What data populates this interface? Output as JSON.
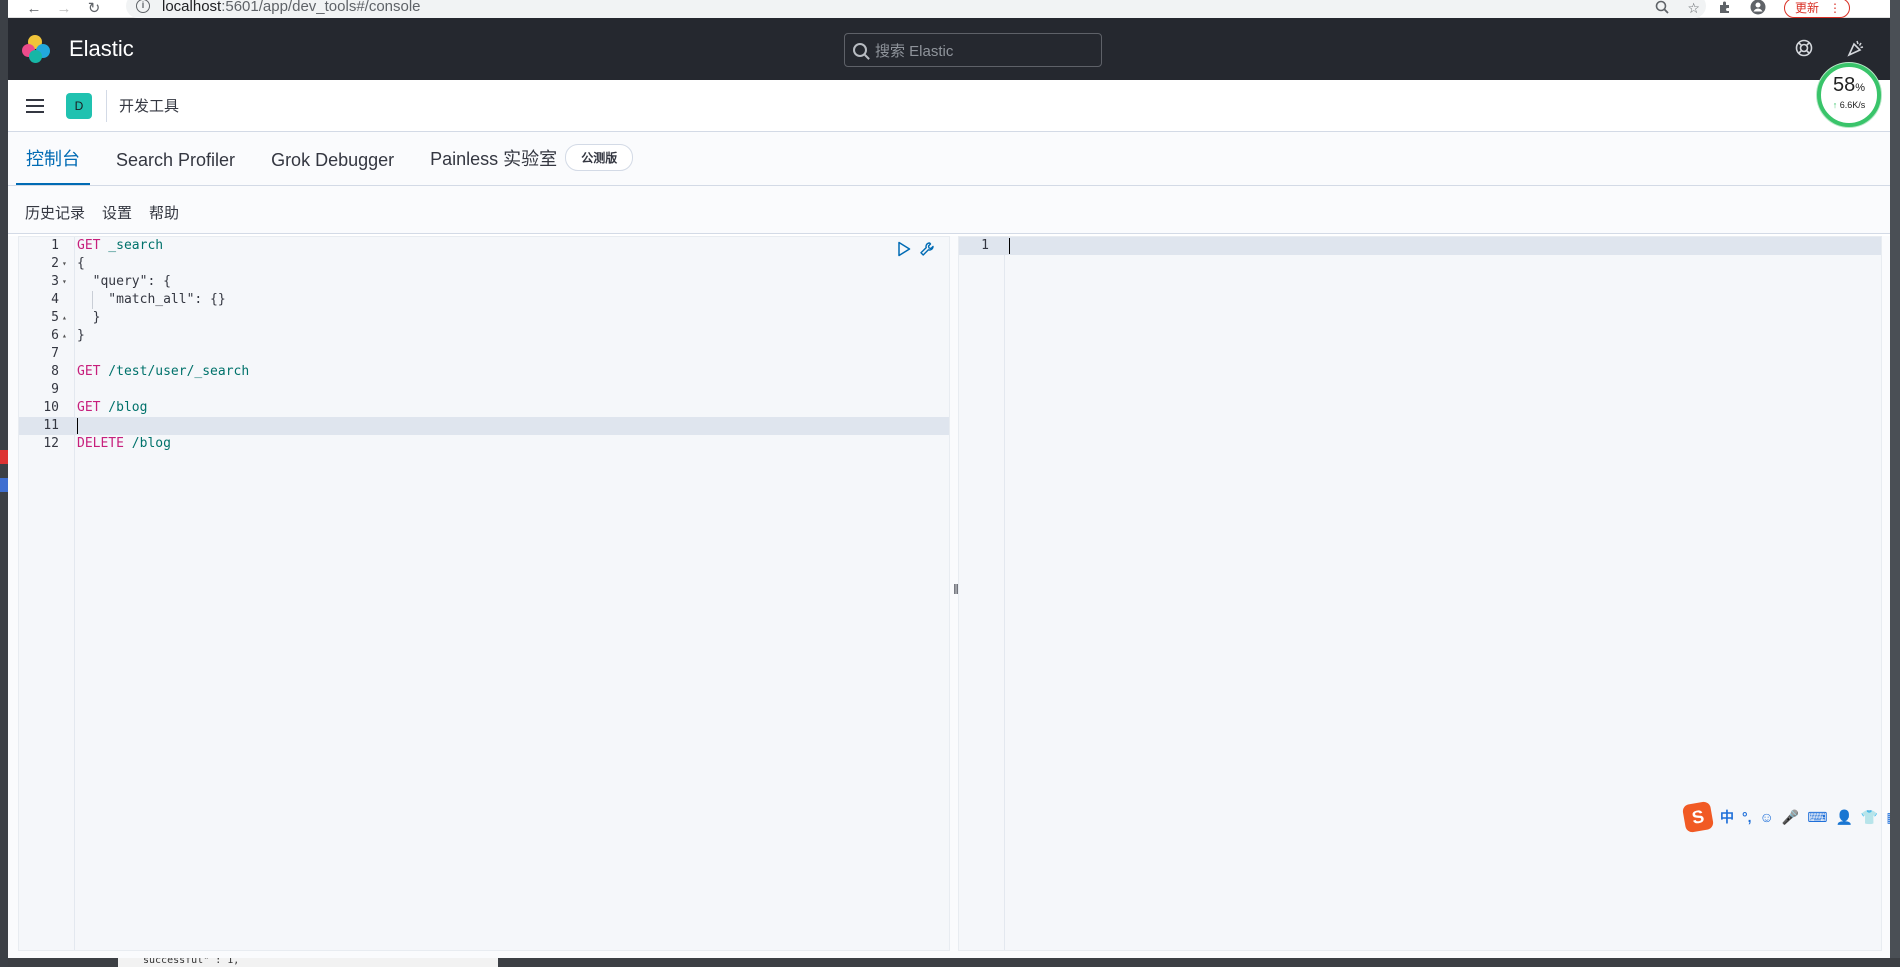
{
  "browser": {
    "url_host": "localhost",
    "url_path": ":5601/app/dev_tools#/console",
    "update_label": "更新",
    "menu_glyph": "⋮"
  },
  "header": {
    "brand": "Elastic",
    "search_placeholder": "搜索 Elastic",
    "icons": [
      "help-icon",
      "newsfeed-icon"
    ]
  },
  "breadcrumb": {
    "space_initial": "D",
    "current": "开发工具"
  },
  "tabs": [
    {
      "label": "控制台",
      "active": true
    },
    {
      "label": "Search Profiler",
      "active": false
    },
    {
      "label": "Grok Debugger",
      "active": false
    },
    {
      "label": "Painless 实验室",
      "active": false,
      "badge": "公测版"
    }
  ],
  "subnav": [
    "历史记录",
    "设置",
    "帮助"
  ],
  "editor": {
    "lines": [
      {
        "n": "1",
        "method": "GET",
        "rest": " _search"
      },
      {
        "n": "2",
        "text": "{"
      },
      {
        "n": "3",
        "text": "  \"query\": {"
      },
      {
        "n": "4",
        "text": "    \"match_all\": {}"
      },
      {
        "n": "5",
        "text": "  }"
      },
      {
        "n": "6",
        "text": "}"
      },
      {
        "n": "7",
        "text": ""
      },
      {
        "n": "8",
        "method": "GET",
        "rest": " /test/user/_search"
      },
      {
        "n": "9",
        "text": ""
      },
      {
        "n": "10",
        "method": "GET",
        "rest": " /blog"
      },
      {
        "n": "11",
        "text": "",
        "active": true
      },
      {
        "n": "12",
        "method": "DELETE",
        "rest": " /blog"
      }
    ]
  },
  "output": {
    "lines": [
      {
        "n": "1",
        "text": ""
      }
    ]
  },
  "resizer_glyph": "‖",
  "perf_widget": {
    "percent": "58",
    "percent_unit": "%",
    "speed_arrow": "↑",
    "speed": "6.6K/s"
  },
  "ime": {
    "logo": "S",
    "items": [
      "中",
      "°,",
      "☺",
      "🎤",
      "⌨",
      "👤",
      "👕",
      "▦"
    ]
  },
  "terminal_snippet": "successful\" : 1,",
  "colors": {
    "accent": "#006bb4",
    "header_bg": "#25282f",
    "keyword": "#c71f7c",
    "url": "#00726b",
    "space_avatar": "#20c2b0"
  }
}
